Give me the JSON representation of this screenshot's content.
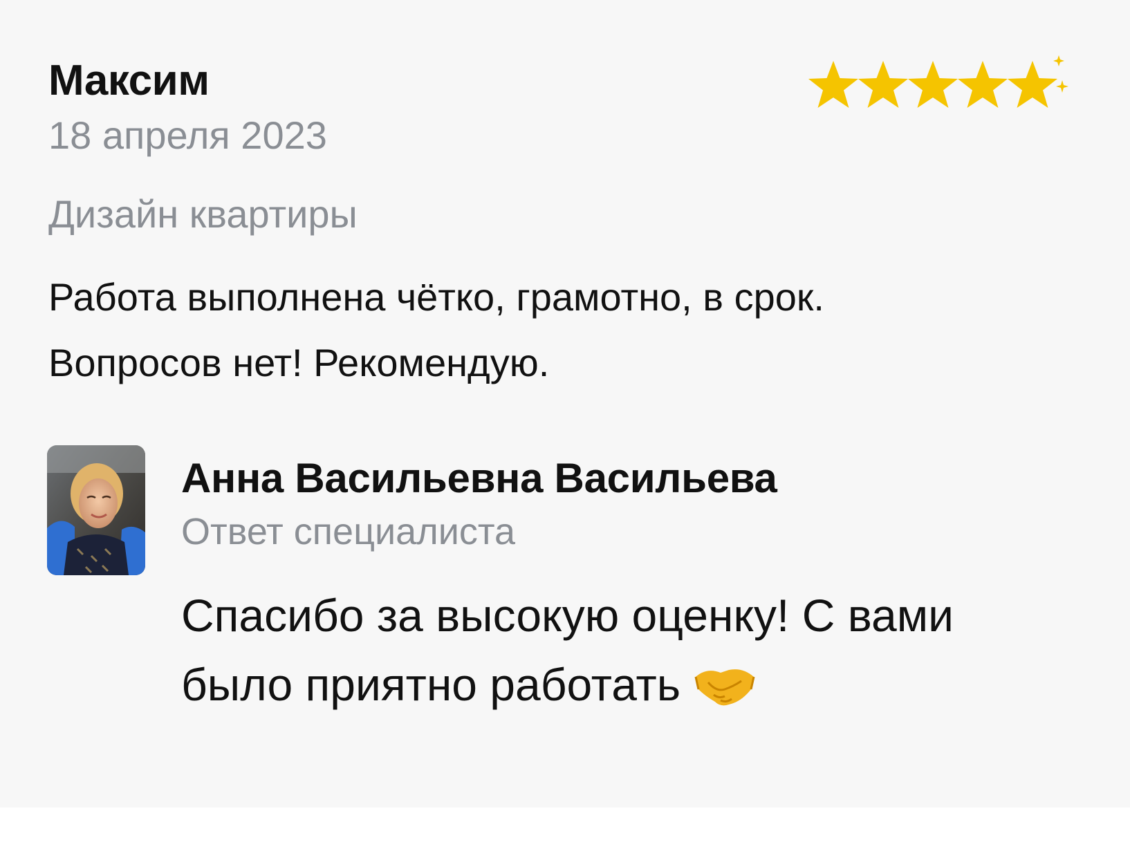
{
  "review": {
    "author": "Максим",
    "date": "18 апреля 2023",
    "category": "Дизайн квартиры",
    "text_line1": "Работа выполнена чётко, грамотно, в срок.",
    "text_line2": "Вопросов нет! Рекомендую.",
    "rating": 5,
    "rating_max": 5,
    "star_color": "#f5c400"
  },
  "reply": {
    "name": "Анна Васильевна Васильева",
    "role": "Ответ специалиста",
    "text_line1": "Спасибо за высокую оценку! С вами",
    "text_line2": "было приятно работать",
    "emoji": "handshake-emoji"
  },
  "colors": {
    "background": "#f7f7f7",
    "muted_text": "#8a8e94",
    "primary_text": "#111111"
  }
}
